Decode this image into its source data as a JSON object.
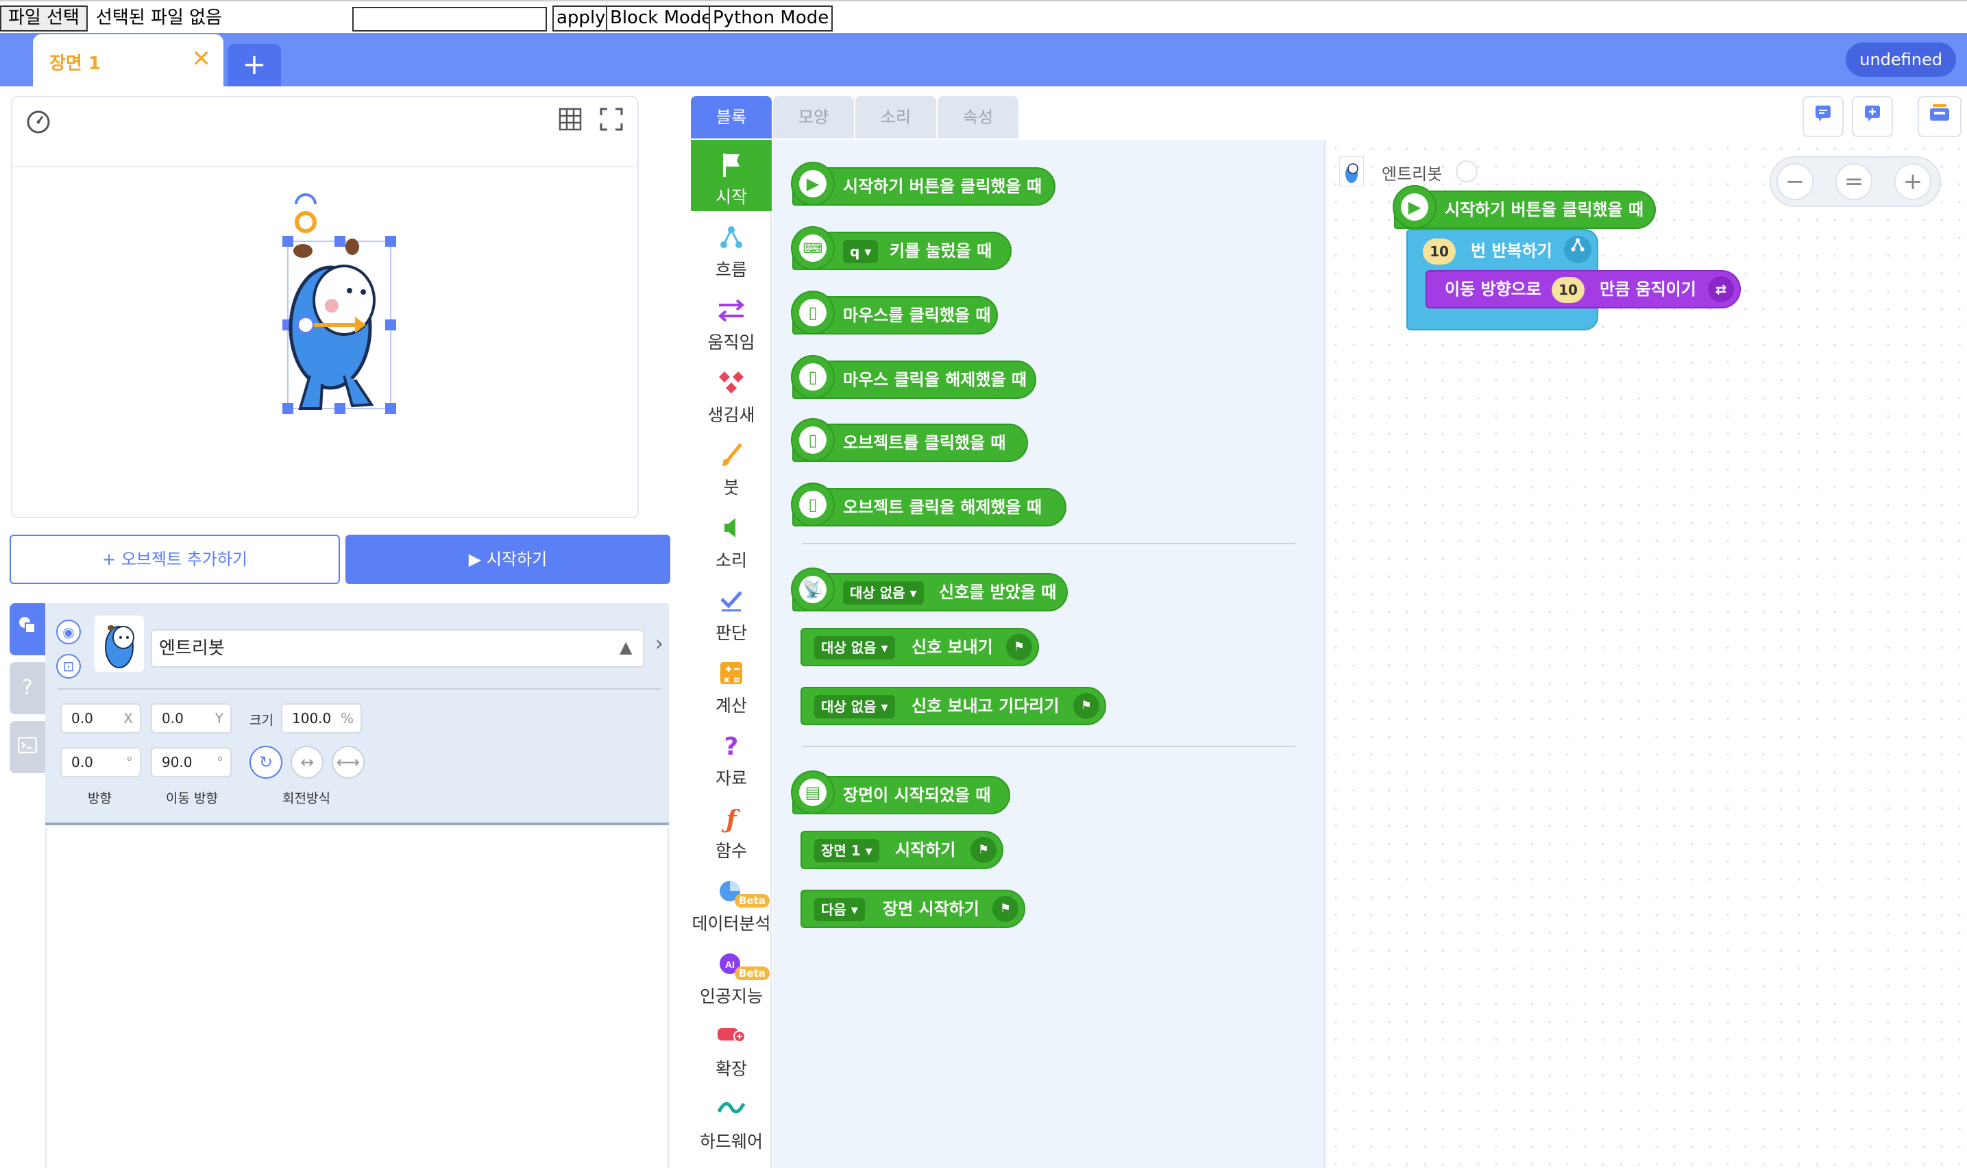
{
  "native_bar": {
    "file_button": "파일 선택",
    "file_status": "선택된 파일 없음",
    "apply": "apply",
    "block_mode": "Block Mode",
    "python_mode": "Python Mode"
  },
  "scene_bar": {
    "tab_label": "장면 1",
    "close": "✕",
    "add": "+",
    "user_badge": "undefined"
  },
  "stage": {
    "add_object": "+ 오브젝트 추가하기",
    "start": "▶ 시작하기"
  },
  "object_panel": {
    "name": "엔트리봇",
    "x": "0.0",
    "x_suffix": "X",
    "y": "0.0",
    "y_suffix": "Y",
    "size_label": "크기",
    "size": "100.0",
    "size_suffix": "%",
    "direction": "0.0",
    "direction_suffix": "°",
    "move_direction": "90.0",
    "move_direction_suffix": "°",
    "direction_label": "방향",
    "move_direction_label": "이동 방향",
    "rotation_label": "회전방식"
  },
  "block_tabs": [
    "블록",
    "모양",
    "소리",
    "속성"
  ],
  "categories": [
    {
      "label": "시작",
      "icon": "flag-icon",
      "color": "#ffffff"
    },
    {
      "label": "흐름",
      "icon": "flow-icon",
      "color": "#4ebbe6"
    },
    {
      "label": "움직임",
      "icon": "arrows-icon",
      "color": "#a33de3"
    },
    {
      "label": "생김새",
      "icon": "looks-icon",
      "color": "#e8455a"
    },
    {
      "label": "붓",
      "icon": "brush-icon",
      "color": "#f5a623"
    },
    {
      "label": "소리",
      "icon": "speaker-icon",
      "color": "#3fb22f"
    },
    {
      "label": "판단",
      "icon": "check-icon",
      "color": "#5b7ff5"
    },
    {
      "label": "계산",
      "icon": "calc-icon",
      "color": "#f5a623"
    },
    {
      "label": "자료",
      "icon": "question-icon",
      "color": "#a33de3"
    },
    {
      "label": "함수",
      "icon": "function-icon",
      "color": "#e8612c"
    },
    {
      "label": "데이터분석",
      "icon": "pie-icon",
      "color": "#4e9bf0",
      "badge": "Beta"
    },
    {
      "label": "인공지능",
      "icon": "ai-icon",
      "color": "#8a3cf0",
      "badge": "Beta"
    },
    {
      "label": "확장",
      "icon": "extension-icon",
      "color": "#e8455a"
    },
    {
      "label": "하드웨어",
      "icon": "hardware-icon",
      "color": "#1aa69a"
    }
  ],
  "palette": {
    "when_start_clicked": "시작하기 버튼을 클릭했을 때",
    "key_dropdown": "q",
    "when_key_pressed": "키를 눌렀을 때",
    "when_mouse_clicked": "마우스를 클릭했을 때",
    "when_mouse_released": "마우스 클릭을 해제했을 때",
    "when_object_clicked": "오브젝트를 클릭했을 때",
    "when_object_released": "오브젝트 클릭을 해제했을 때",
    "signal_target": "대상 없음",
    "when_signal_received": "신호를 받았을 때",
    "send_signal": "신호 보내기",
    "send_signal_wait": "신호 보내고 기다리기",
    "when_scene_started": "장면이 시작되었을 때",
    "scene_dropdown": "장면 1",
    "start_scene": "시작하기",
    "next_dropdown": "다음",
    "start_next_scene": "장면 시작하기"
  },
  "workspace": {
    "object_name": "엔트리봇",
    "hat_text": "시작하기 버튼을 클릭했을 때",
    "repeat_count": "10",
    "repeat_text": "번 반복하기",
    "move_text_1": "이동 방향으로",
    "move_value": "10",
    "move_text_2": "만큼 움직이기",
    "zoom_out": "−",
    "zoom_reset": "=",
    "zoom_in": "+"
  }
}
